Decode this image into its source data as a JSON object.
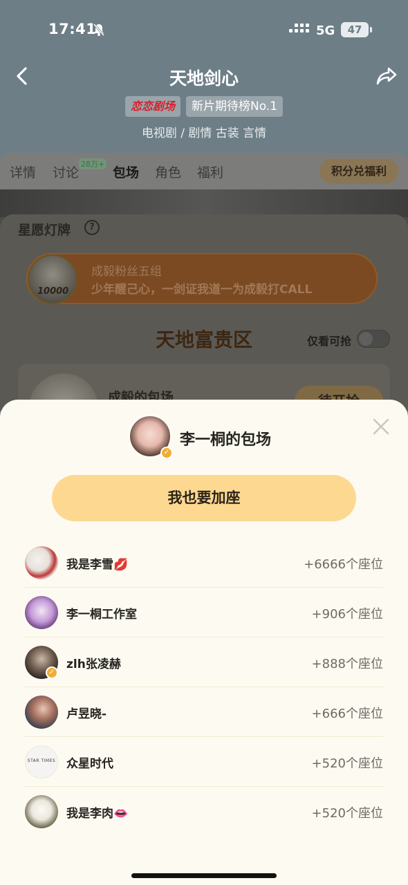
{
  "status_bar": {
    "time": "17:41",
    "network": "5G",
    "battery": "47"
  },
  "header": {
    "title": "天地剑心",
    "brand_tag": "恋恋剧场",
    "rank_tag": "新片期待榜No.1",
    "genre": "电视剧 / 剧情 古装 言情"
  },
  "tabs": [
    {
      "label": "详情"
    },
    {
      "label": "讨论",
      "badge": "28万+"
    },
    {
      "label": "包场"
    },
    {
      "label": "角色"
    },
    {
      "label": "福利"
    }
  ],
  "redeem_label": "积分兑福利",
  "background": {
    "star_wish_title": "星愿灯牌",
    "help": "?",
    "lamp": {
      "score": "10000",
      "line1": "成毅粉丝五组",
      "line2": "少年醒己心，一剑证我道一为成毅打CALL"
    },
    "zone_title": "天地富贵区",
    "toggle_label": "仅看可抢",
    "card": {
      "name": "成毅的包场",
      "button": "待开抢"
    }
  },
  "sheet": {
    "title": "李一桐的包场",
    "join_button": "我也要加座",
    "rows": [
      {
        "name": "我是李雪💋",
        "seats": "+6666个座位"
      },
      {
        "name": "李一桐工作室",
        "seats": "+906个座位"
      },
      {
        "name": "zlh张凌赫",
        "seats": "+888个座位"
      },
      {
        "name": "卢昱晓-",
        "seats": "+666个座位"
      },
      {
        "name": "众星时代",
        "seats": "+520个座位"
      },
      {
        "name": "我是李肉👄",
        "seats": "+520个座位"
      }
    ],
    "logo_text": "STAR TIMES"
  },
  "colors": {
    "accent": "#fdd891",
    "sheet_bg": "#fdfbf1",
    "verify": "#f1ad34"
  }
}
